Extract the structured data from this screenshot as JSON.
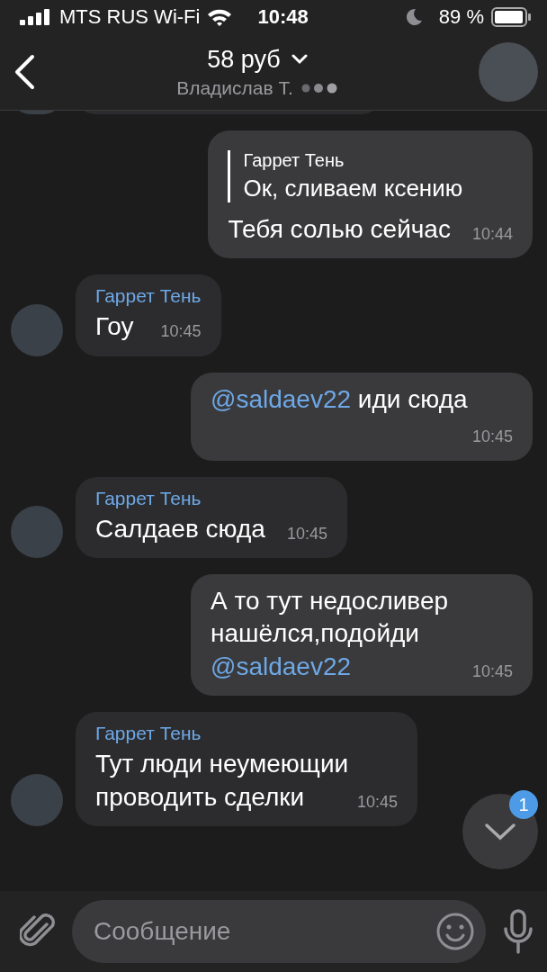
{
  "status_bar": {
    "carrier": "MTS RUS Wi-Fi",
    "time": "10:48",
    "battery": "89 %"
  },
  "header": {
    "title": "58 руб",
    "subtitle": "Владислав Т."
  },
  "messages": [
    {
      "kind": "incoming-cut"
    },
    {
      "kind": "outgoing",
      "reply": {
        "author": "Гаррет Тень",
        "text": "Ок, сливаем ксению"
      },
      "parts": [
        {
          "kind": "plain",
          "text": "Тебя солью сейчас"
        }
      ],
      "time": "10:44"
    },
    {
      "kind": "incoming",
      "sender": "Гаррет Тень",
      "parts": [
        {
          "kind": "plain",
          "text": "Гоу"
        }
      ],
      "time": "10:45"
    },
    {
      "kind": "outgoing",
      "parts": [
        {
          "kind": "mention",
          "text": "@saldaev22"
        },
        {
          "kind": "plain",
          "text": " иди сюда"
        }
      ],
      "time": "10:45"
    },
    {
      "kind": "incoming",
      "sender": "Гаррет Тень",
      "parts": [
        {
          "kind": "plain",
          "text": "Салдаев сюда"
        }
      ],
      "time": "10:45"
    },
    {
      "kind": "outgoing",
      "parts": [
        {
          "kind": "plain",
          "text": "А то тут недосливер нашёлся,подойди "
        },
        {
          "kind": "mention",
          "text": "@saldaev22"
        }
      ],
      "time": "10:45"
    },
    {
      "kind": "incoming",
      "sender": "Гаррет Тень",
      "parts": [
        {
          "kind": "plain",
          "text": "Тут люди неумеющии проводить сделки"
        }
      ],
      "time": "10:45"
    }
  ],
  "scroll_button": {
    "badge": "1"
  },
  "composer": {
    "placeholder": "Сообщение"
  }
}
